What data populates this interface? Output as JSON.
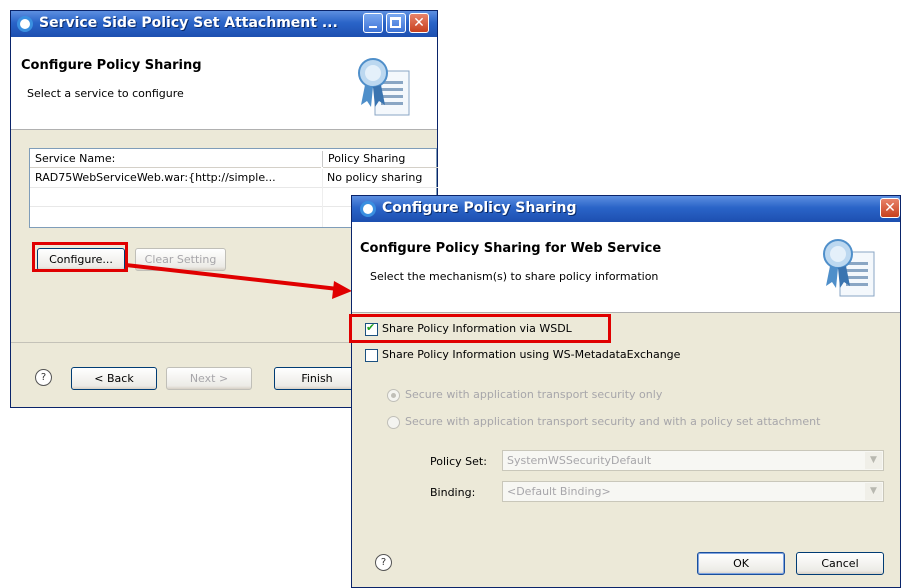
{
  "back_window": {
    "title": "Service Side Policy Set Attachment ...",
    "header_title": "Configure Policy Sharing",
    "header_subtitle": "Select a service to configure",
    "table": {
      "columns": [
        "Service Name:",
        "Policy Sharing"
      ],
      "rows": [
        [
          "RAD75WebServiceWeb.war:{http://simple...",
          "No policy sharing"
        ]
      ]
    },
    "configure_label": "Configure...",
    "clear_label": "Clear Setting",
    "help_glyph": "?",
    "back_label": "< Back",
    "next_label": "Next >",
    "finish_label": "Finish",
    "close_glyph": "✕"
  },
  "front_dialog": {
    "title": "Configure Policy Sharing",
    "header_title": "Configure Policy Sharing for Web Service",
    "header_subtitle": "Select the mechanism(s) to share policy information",
    "share_wsdl_label": "Share Policy Information via WSDL",
    "share_wsdl_checked": true,
    "share_mex_label": "Share Policy Information using WS-MetadataExchange",
    "share_mex_checked": false,
    "radio_transport_label": "Secure with application transport security only",
    "radio_policyset_label": "Secure with application transport security and with a policy set attachment",
    "policy_set_label": "Policy Set:",
    "policy_set_value": "SystemWSSecurityDefault",
    "binding_label": "Binding:",
    "binding_value": "<Default Binding>",
    "help_glyph": "?",
    "ok_label": "OK",
    "cancel_label": "Cancel",
    "close_glyph": "✕",
    "combo_arrow_glyph": "▼"
  },
  "colors": {
    "highlight_red": "#e00000",
    "title_blue": "#2a64c8",
    "dialog_bg": "#ece9d8"
  },
  "icons": [
    "window-app-icon",
    "minimize-icon",
    "maximize-icon",
    "close-icon",
    "policy-certificate-icon",
    "help-icon",
    "arrow-annotation"
  ]
}
